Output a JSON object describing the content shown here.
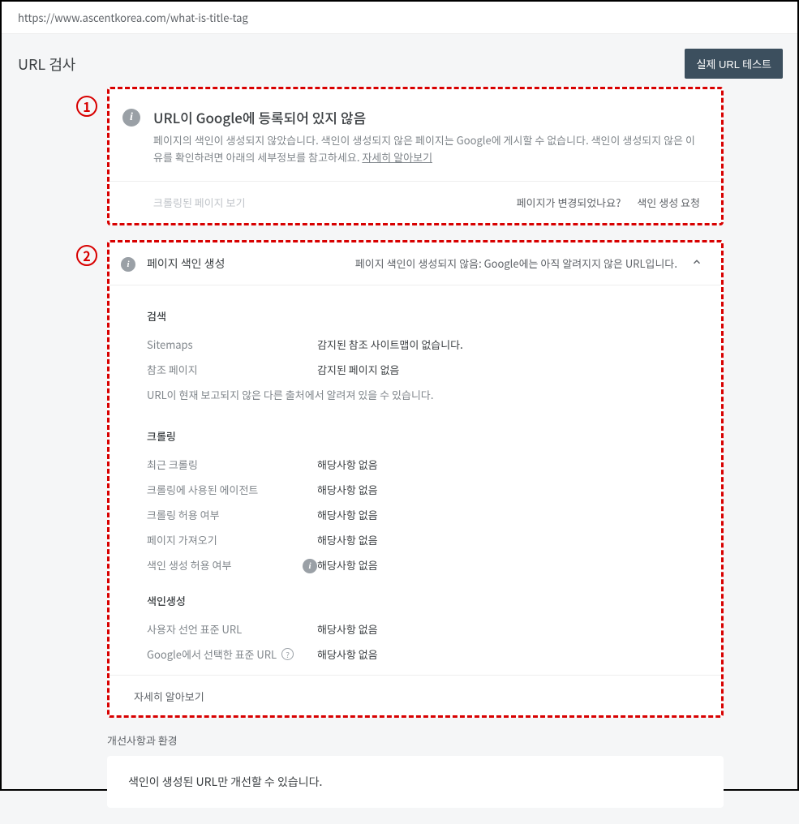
{
  "url": "https://www.ascentkorea.com/what-is-title-tag",
  "page_title": "URL 검사",
  "test_button": "실제 URL 테스트",
  "badges": {
    "one": "1",
    "two": "2"
  },
  "card1": {
    "title": "URL이 Google에 등록되어 있지 않음",
    "desc": "페이지의 색인이 생성되지 않았습니다. 색인이 생성되지 않은 페이지는 Google에 게시할 수 없습니다. 색인이 생성되지 않은 이유를 확인하려면 아래의 세부정보를 참고하세요. ",
    "learn_more": "자세히 알아보기",
    "view_crawled": "크롤링된 페이지 보기",
    "page_changed": "페이지가 변경되었나요?",
    "request_index": "색인 생성 요청"
  },
  "card2": {
    "header_label": "페이지 색인 생성",
    "header_status": "페이지 색인이 생성되지 않음: Google에는 아직 알려지지 않은 URL입니다.",
    "sections": {
      "discovery": {
        "title": "검색",
        "rows": [
          {
            "key": "Sitemaps",
            "val": "감지된 참조 사이트맵이 없습니다."
          },
          {
            "key": "참조 페이지",
            "val": "감지된 페이지 없음"
          }
        ],
        "note": "URL이 현재 보고되지 않은 다른 출처에서 알려져 있을 수 있습니다."
      },
      "crawl": {
        "title": "크롤링",
        "rows": [
          {
            "key": "최근 크롤링",
            "val": "해당사항 없음"
          },
          {
            "key": "크롤링에 사용된 에이전트",
            "val": "해당사항 없음"
          },
          {
            "key": "크롤링 허용 여부",
            "val": "해당사항 없음"
          },
          {
            "key": "페이지 가져오기",
            "val": "해당사항 없음"
          },
          {
            "key": "색인 생성 허용 여부",
            "val": "해당사항 없음",
            "info": true
          }
        ]
      },
      "indexing": {
        "title": "색인생성",
        "rows": [
          {
            "key": "사용자 선언 표준 URL",
            "val": "해당사항 없음"
          },
          {
            "key": "Google에서 선택한 표준 URL",
            "val": "해당사항 없음",
            "help": true
          }
        ]
      }
    },
    "footer": "자세히 알아보기"
  },
  "improvements": {
    "heading": "개선사항과 환경",
    "message": "색인이 생성된 URL만 개선할 수 있습니다."
  }
}
